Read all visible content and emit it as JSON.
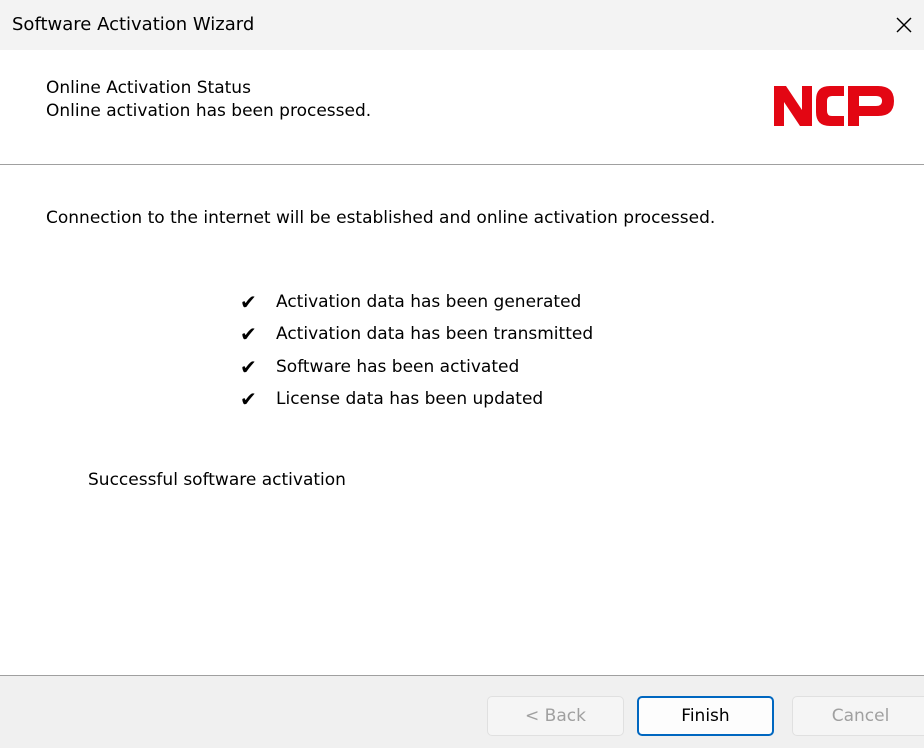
{
  "window": {
    "title": "Software Activation Wizard",
    "close_icon": "close-icon"
  },
  "header": {
    "title": "Online Activation Status",
    "subtitle": "Online activation has been processed.",
    "logo": {
      "text": "NCP",
      "color": "#e30613"
    }
  },
  "content": {
    "intro": "Connection to the internet will be established and online activation processed.",
    "checklist": [
      {
        "mark": "✔",
        "label": "Activation data has been generated"
      },
      {
        "mark": "✔",
        "label": "Activation data has been transmitted"
      },
      {
        "mark": "✔",
        "label": "Software has been activated"
      },
      {
        "mark": "✔",
        "label": "License data has been updated"
      }
    ],
    "result": "Successful software activation"
  },
  "footer": {
    "back_label": "< Back",
    "finish_label": "Finish",
    "cancel_label": "Cancel",
    "focus_color": "#0067c0"
  }
}
